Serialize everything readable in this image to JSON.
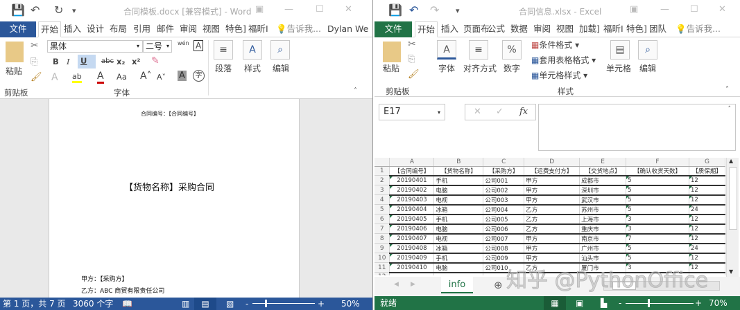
{
  "word": {
    "title": "合同模板.docx [兼容模式] - Word",
    "tabs": [
      "文件",
      "开始",
      "插入",
      "设计",
      "布局",
      "引用",
      "邮件",
      "审阅",
      "视图",
      "特色]",
      "福昕I"
    ],
    "tell_me": "告诉我...",
    "user": "Dylan We",
    "font_name": "黑体",
    "font_size": "二号",
    "paste": "粘贴",
    "group_clipboard": "剪贴板",
    "group_font": "字体",
    "paragraph": "段落",
    "styles": "样式",
    "editing": "编辑",
    "fmt": {
      "bold": "B",
      "italic": "I",
      "underline": "U",
      "strike": "abc",
      "sub": "x₂",
      "sup": "x²",
      "grow": "Aa",
      "phonetic": "wén",
      "A": "A"
    },
    "doc": {
      "contract_no": "合同编号：【合同编号】",
      "heading": "【货物名称】采购合同",
      "party_a": "甲方：【采购方】",
      "party_b": "乙方：ABC 商贸有限责任公司"
    },
    "status": {
      "page": "第 1 页，共 7 页",
      "words": "3060 个字",
      "zoom": "50%",
      "zoom_fraction": 0.5
    }
  },
  "excel": {
    "title": "合同信息.xlsx - Excel",
    "tabs": [
      "文件",
      "开始",
      "插入",
      "页面布",
      "公式",
      "数据",
      "审阅",
      "视图",
      "加载]",
      "福昕I",
      "特色]",
      "团队"
    ],
    "tell_me": "告诉我...",
    "paste": "粘贴",
    "group_clipboard": "剪贴板",
    "font": "字体",
    "align": "对齐方式",
    "number": "数字",
    "cond_format": "条件格式 ▾",
    "table_format": "套用表格格式 ▾",
    "cell_style": "单元格样式 ▾",
    "group_styles": "样式",
    "cells": "单元格",
    "editing": "编辑",
    "name_box": "E17",
    "fx": "fx",
    "columns": [
      "A",
      "B",
      "C",
      "D",
      "E",
      "F",
      "G"
    ],
    "header": [
      "【合同编号】",
      "【货物名称】",
      "【采购方】",
      "【运费支付方】",
      "【交货地点】",
      "【确认收货天数】",
      "【质保期】"
    ],
    "rows": [
      [
        "20190401",
        "手机",
        "公司001",
        "甲方",
        "成都市",
        "5",
        "12"
      ],
      [
        "20190402",
        "电脑",
        "公司002",
        "甲方",
        "深圳市",
        "5",
        "12"
      ],
      [
        "20190403",
        "电视",
        "公司003",
        "甲方",
        "武汉市",
        "5",
        "12"
      ],
      [
        "20190404",
        "冰箱",
        "公司004",
        "乙方",
        "苏州市",
        "5",
        "24"
      ],
      [
        "20190405",
        "手机",
        "公司005",
        "乙方",
        "上海市",
        "3",
        "12"
      ],
      [
        "20190406",
        "电脑",
        "公司006",
        "乙方",
        "重庆市",
        "3",
        "12"
      ],
      [
        "20190407",
        "电视",
        "公司007",
        "甲方",
        "南京市",
        "7",
        "12"
      ],
      [
        "20190408",
        "冰箱",
        "公司008",
        "甲方",
        "广州市",
        "5",
        "24"
      ],
      [
        "20190409",
        "手机",
        "公司009",
        "甲方",
        "汕头市",
        "5",
        "12"
      ],
      [
        "20190410",
        "电脑",
        "公司010",
        "乙方",
        "厦门市",
        "3",
        "12"
      ]
    ],
    "sheet_tab": "info",
    "status": {
      "ready": "就绪",
      "zoom": "70%",
      "zoom_fraction": 0.7
    }
  },
  "watermark": "知乎 @PythonOffice",
  "colors": {
    "word": "#2b579a",
    "excel": "#217346"
  }
}
